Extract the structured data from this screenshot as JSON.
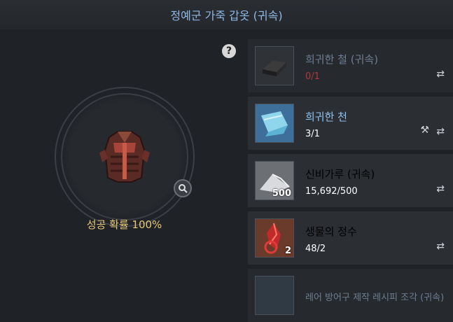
{
  "window": {
    "title": "정예군 가죽 갑옷 (귀속)"
  },
  "help": {
    "label": "?"
  },
  "craft": {
    "success_rate": "성공 확률 100%"
  },
  "materials": [
    {
      "name": "희귀한 철 (귀속)",
      "count": "0/1",
      "qty": "",
      "icon": "iron-ingot-icon",
      "name_color": "#6d7f94",
      "count_color": "#b23a3a",
      "disabled": true
    },
    {
      "name": "희귀한 천",
      "count": "3/1",
      "qty": "",
      "icon": "fabric-icon",
      "name_color": "#8fc2f2",
      "count_color": "#ffffff",
      "disabled": false
    },
    {
      "name": "신비가루 (귀속)",
      "count": "15,692/500",
      "qty": "500",
      "icon": "powder-icon",
      "name_color": "#ffffff",
      "count_color": "#ffffff",
      "disabled": false
    },
    {
      "name": "생물의 정수",
      "count": "48/2",
      "qty": "2",
      "icon": "essence-icon",
      "name_color": "#ffffff",
      "count_color": "#ffffff",
      "disabled": false
    },
    {
      "name": "레어 방어구 제작 레시피 조각 (귀속)",
      "count": "",
      "qty": "",
      "icon": "recipe-icon",
      "name_color": "#6d7f94",
      "count_color": "#ffffff",
      "disabled": true
    }
  ]
}
